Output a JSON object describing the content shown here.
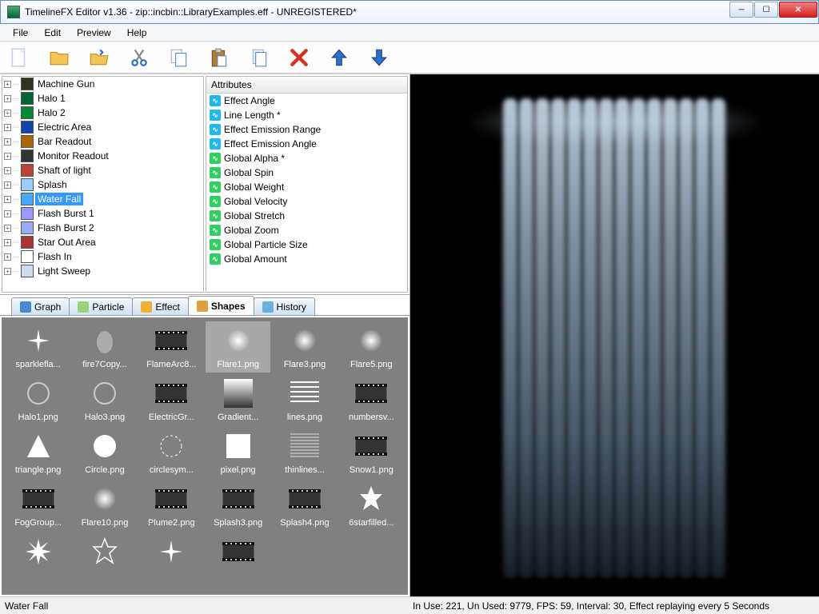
{
  "window": {
    "title": "TimelineFX Editor v1.36 - zip::incbin::LibraryExamples.eff - UNREGISTERED*"
  },
  "menu": [
    "File",
    "Edit",
    "Preview",
    "Help"
  ],
  "toolbar_icons": [
    "new-file-icon",
    "open-folder-icon",
    "save-icon",
    "cut-icon",
    "copy-icon",
    "paste-icon",
    "duplicate-icon",
    "delete-icon",
    "move-up-icon",
    "move-down-icon"
  ],
  "tree": [
    {
      "label": "Machine Gun",
      "sel": false
    },
    {
      "label": "Halo 1",
      "sel": false
    },
    {
      "label": "Halo 2",
      "sel": false
    },
    {
      "label": "Electric Area",
      "sel": false
    },
    {
      "label": "Bar Readout",
      "sel": false
    },
    {
      "label": "Monitor Readout",
      "sel": false
    },
    {
      "label": "Shaft of light",
      "sel": false
    },
    {
      "label": "Splash",
      "sel": false
    },
    {
      "label": "Water Fall",
      "sel": true
    },
    {
      "label": "Flash Burst 1",
      "sel": false
    },
    {
      "label": "Flash Burst 2",
      "sel": false
    },
    {
      "label": "Star Out Area",
      "sel": false
    },
    {
      "label": "Flash In",
      "sel": false
    },
    {
      "label": "Light Sweep",
      "sel": false
    }
  ],
  "attr_header": "Attributes",
  "attributes": [
    {
      "label": "Effect Angle",
      "color": "blue"
    },
    {
      "label": "Line Length *",
      "color": "blue"
    },
    {
      "label": "Effect Emission Range",
      "color": "blue"
    },
    {
      "label": "Effect Emission Angle",
      "color": "blue"
    },
    {
      "label": "Global Alpha *",
      "color": "green"
    },
    {
      "label": "Global Spin",
      "color": "green"
    },
    {
      "label": "Global Weight",
      "color": "green"
    },
    {
      "label": "Global Velocity",
      "color": "green"
    },
    {
      "label": "Global Stretch",
      "color": "green"
    },
    {
      "label": "Global Zoom",
      "color": "green"
    },
    {
      "label": "Global Particle Size",
      "color": "green"
    },
    {
      "label": "Global Amount",
      "color": "green"
    }
  ],
  "tabs": [
    {
      "label": "Graph",
      "active": false
    },
    {
      "label": "Particle",
      "active": false
    },
    {
      "label": "Effect",
      "active": false
    },
    {
      "label": "Shapes",
      "active": true
    },
    {
      "label": "History",
      "active": false
    }
  ],
  "shapes": [
    {
      "label": "sparklefla...",
      "sel": false,
      "kind": "sparkle"
    },
    {
      "label": "fire7Copy...",
      "sel": false,
      "kind": "fire"
    },
    {
      "label": "FlameArc8...",
      "sel": false,
      "kind": "film"
    },
    {
      "label": "Flare1.png",
      "sel": true,
      "kind": "flare"
    },
    {
      "label": "Flare3.png",
      "sel": false,
      "kind": "flare"
    },
    {
      "label": "Flare5.png",
      "sel": false,
      "kind": "flare"
    },
    {
      "label": "Halo1.png",
      "sel": false,
      "kind": "halo"
    },
    {
      "label": "Halo3.png",
      "sel": false,
      "kind": "halo"
    },
    {
      "label": "ElectricGr...",
      "sel": false,
      "kind": "film"
    },
    {
      "label": "Gradient...",
      "sel": false,
      "kind": "gradient"
    },
    {
      "label": "lines.png",
      "sel": false,
      "kind": "lines"
    },
    {
      "label": "numbersv...",
      "sel": false,
      "kind": "film"
    },
    {
      "label": "triangle.png",
      "sel": false,
      "kind": "triangle"
    },
    {
      "label": "Circle.png",
      "sel": false,
      "kind": "circle"
    },
    {
      "label": "circlesym...",
      "sel": false,
      "kind": "ring"
    },
    {
      "label": "pixel.png",
      "sel": false,
      "kind": "square"
    },
    {
      "label": "thinlines...",
      "sel": false,
      "kind": "thinlines"
    },
    {
      "label": "Snow1.png",
      "sel": false,
      "kind": "film"
    },
    {
      "label": "FogGroup...",
      "sel": false,
      "kind": "film"
    },
    {
      "label": "Flare10.png",
      "sel": false,
      "kind": "flare"
    },
    {
      "label": "Plume2.png",
      "sel": false,
      "kind": "film"
    },
    {
      "label": "Splash3.png",
      "sel": false,
      "kind": "film"
    },
    {
      "label": "Splash4.png",
      "sel": false,
      "kind": "film"
    },
    {
      "label": "6starfilled...",
      "sel": false,
      "kind": "star6"
    },
    {
      "label": "",
      "sel": false,
      "kind": "star8"
    },
    {
      "label": "",
      "sel": false,
      "kind": "staroutline"
    },
    {
      "label": "",
      "sel": false,
      "kind": "sparkle"
    },
    {
      "label": "",
      "sel": false,
      "kind": "film"
    }
  ],
  "status": {
    "left": "Water Fall",
    "right": "In Use: 221, Un Used: 9779, FPS: 59, Interval: 30, Effect replaying every 5 Seconds"
  }
}
